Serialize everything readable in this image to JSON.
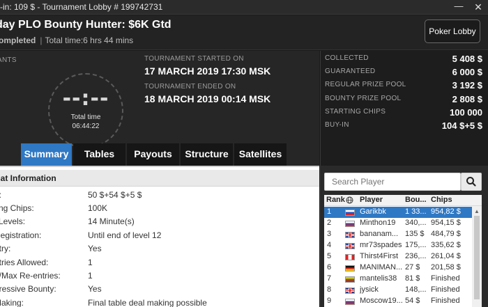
{
  "window": {
    "title": "y-in: 109 $ - Tournament Lobby # 199742731",
    "minimize": "—",
    "close": "✕"
  },
  "header": {
    "tournament_name": "day PLO Bounty Hunter: $6K Gtd",
    "status": "ompleted",
    "total_time": "Total time:6 hrs  44 mins",
    "lobby_button": "Poker Lobby"
  },
  "info": {
    "entrants_label": "ANTS",
    "timer_clock": "--:--",
    "timer_label": "Total time",
    "timer_value": "06:44:22",
    "started_label": "TOURNAMENT STARTED ON",
    "started_value": "17 MARCH 2019  17:30 MSK",
    "ended_label": "TOURNAMENT ENDED ON",
    "ended_value": "18 MARCH 2019  00:14 MSK"
  },
  "stats": [
    {
      "label": "COLLECTED",
      "value": "5 408 $"
    },
    {
      "label": "GUARANTEED",
      "value": "6 000 $"
    },
    {
      "label": "REGULAR PRIZE POOL",
      "value": "3 192 $"
    },
    {
      "label": "BOUNTY PRIZE POOL",
      "value": "2 808 $"
    },
    {
      "label": "STARTING CHIPS",
      "value": "100 000"
    },
    {
      "label": "BUY-IN",
      "value": "104 $+5 $"
    }
  ],
  "tabs": [
    "Summary",
    "Tables",
    "Payouts",
    "Structure",
    "Satellites"
  ],
  "format": {
    "heading": "mat Information",
    "rows": [
      {
        "key": "n:",
        "value": "50 $+54 $+5 $"
      },
      {
        "key": "ting Chips:",
        "value": "100K"
      },
      {
        "key": "l Levels:",
        "value": "14 Minute(s)"
      },
      {
        "key": "Registration:",
        "value": "Until end of level 12"
      },
      {
        "key": "ntry:",
        "value": "Yes"
      },
      {
        "key": "ntries Allowed:",
        "value": "1"
      },
      {
        "key": "d/Max Re-entries:",
        "value": "1"
      },
      {
        "key": "gressive Bounty:",
        "value": "Yes"
      },
      {
        "key": "Making:",
        "value": "Final table deal making possible"
      }
    ]
  },
  "players": {
    "search_placeholder": "Search Player",
    "columns": {
      "rank": "Rank",
      "player": "Player",
      "bounty": "Bou...",
      "chips": "Chips"
    },
    "rows": [
      {
        "rank": "1",
        "flag": "ru",
        "name": "Garikbk",
        "bounty": "1 33...",
        "chips": "954,82 $"
      },
      {
        "rank": "2",
        "flag": "ru",
        "name": "Minthon19",
        "bounty": "340,...",
        "chips": "954,15 $"
      },
      {
        "rank": "3",
        "flag": "gb",
        "name": "bananam...",
        "bounty": "135 $",
        "chips": "484,79 $"
      },
      {
        "rank": "4",
        "flag": "gb",
        "name": "mr73spades",
        "bounty": "175,...",
        "chips": "335,62 $"
      },
      {
        "rank": "5",
        "flag": "ca",
        "name": "Thirst4First",
        "bounty": "236,...",
        "chips": "261,04 $"
      },
      {
        "rank": "6",
        "flag": "de",
        "name": "MANIMAN...",
        "bounty": "27 $",
        "chips": "201,58 $"
      },
      {
        "rank": "7",
        "flag": "lt",
        "name": "mantelis38",
        "bounty": "81 $",
        "chips": "Finished"
      },
      {
        "rank": "8",
        "flag": "gb",
        "name": "jysick",
        "bounty": "148,...",
        "chips": "Finished"
      },
      {
        "rank": "9",
        "flag": "ru",
        "name": "Moscow19...",
        "bounty": "54 $",
        "chips": "Finished"
      }
    ]
  },
  "colors": {
    "accent": "#2f78c4",
    "background": "#1a1a1a"
  }
}
